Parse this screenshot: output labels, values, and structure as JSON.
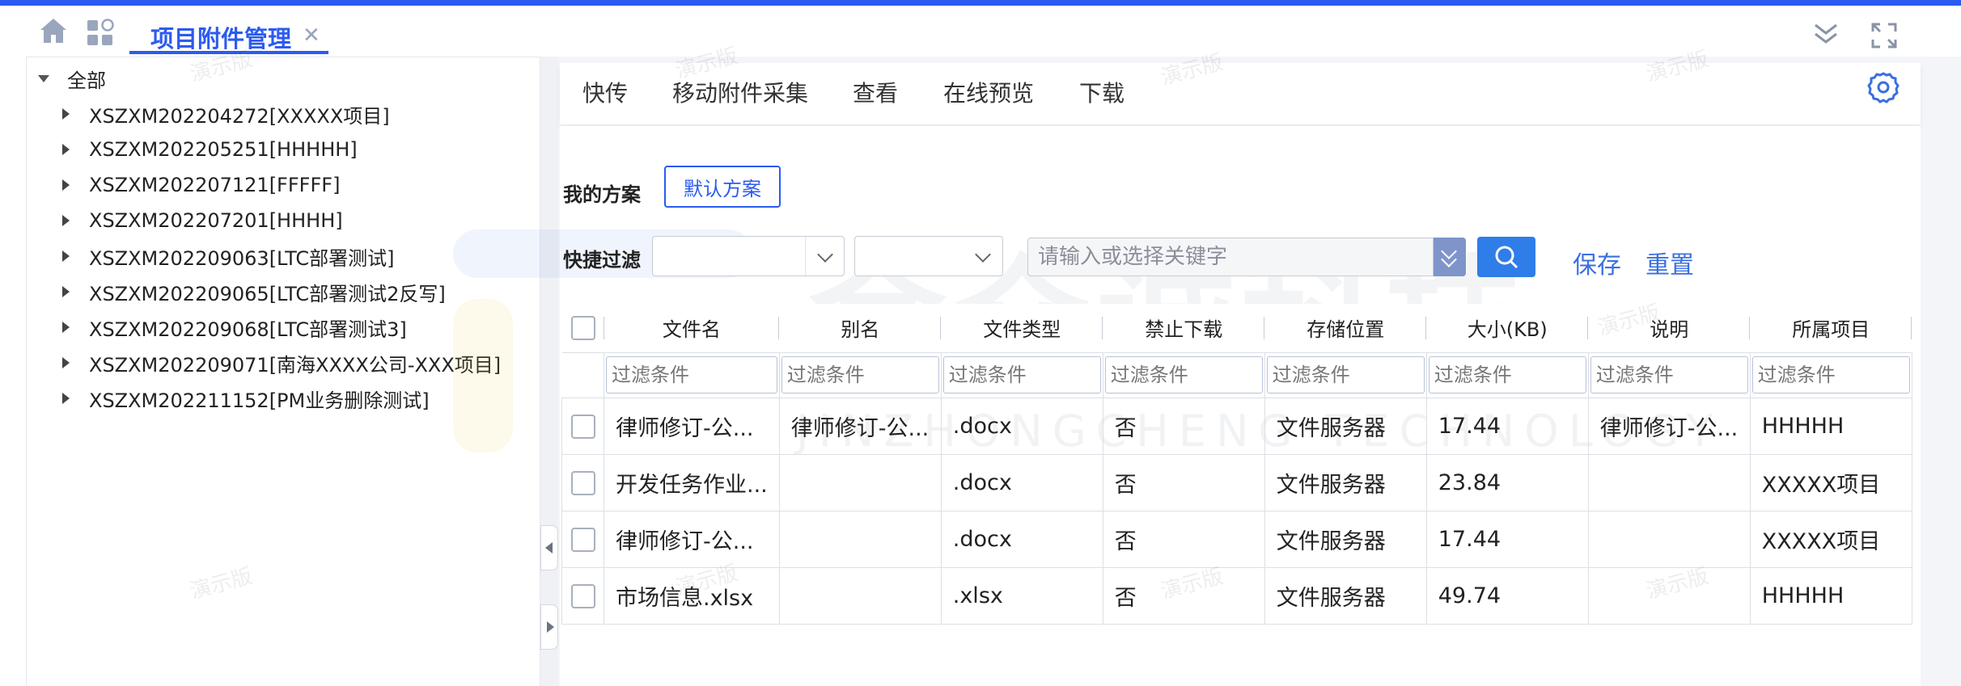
{
  "tabs": {
    "active_label": "项目附件管理"
  },
  "tree": {
    "root": "全部",
    "items": [
      "XSZXM202204272[XXXXX项目]",
      "XSZXM202205251[HHHHH]",
      "XSZXM202207121[FFFFF]",
      "XSZXM202207201[HHHH]",
      "XSZXM202209063[LTC部署测试]",
      "XSZXM202209065[LTC部署测试2反写]",
      "XSZXM202209068[LTC部署测试3]",
      "XSZXM202209071[南海XXXX公司-XXX项目]",
      "XSZXM202211152[PM业务删除测试]"
    ]
  },
  "toolbar": {
    "quick_upload": "快传",
    "mobile_collect": "移动附件采集",
    "view": "查看",
    "online_preview": "在线预览",
    "download": "下载"
  },
  "scheme": {
    "label": "我的方案",
    "default_button": "默认方案"
  },
  "quick_filter": {
    "label": "快捷过滤",
    "keyword_placeholder": "请输入或选择关键字",
    "save": "保存",
    "reset": "重置"
  },
  "table": {
    "filter_placeholder": "过滤条件",
    "columns": [
      "文件名",
      "别名",
      "文件类型",
      "禁止下载",
      "存储位置",
      "大小(KB)",
      "说明",
      "所属项目"
    ],
    "rows": [
      [
        "律师修订-公...",
        "律师修订-公...",
        ".docx",
        "否",
        "文件服务器",
        "17.44",
        "律师修订-公...",
        "HHHHH"
      ],
      [
        "开发任务作业...",
        "",
        ".docx",
        "否",
        "文件服务器",
        "23.84",
        "",
        "XXXXX项目"
      ],
      [
        "律师修订-公...",
        "",
        ".docx",
        "否",
        "文件服务器",
        "17.44",
        "",
        "XXXXX项目"
      ],
      [
        "市场信息.xlsx",
        "",
        ".xlsx",
        "否",
        "文件服务器",
        "49.74",
        "",
        "HHHHH"
      ]
    ]
  },
  "watermark": {
    "text": "演示版",
    "brand_cn": "金众诚科技",
    "brand_en": "JINZHONGCHENG TECHNOLOGY"
  },
  "colors": {
    "accent": "#2b5bf0",
    "link": "#3a6fe0",
    "search": "#2f7de8"
  }
}
